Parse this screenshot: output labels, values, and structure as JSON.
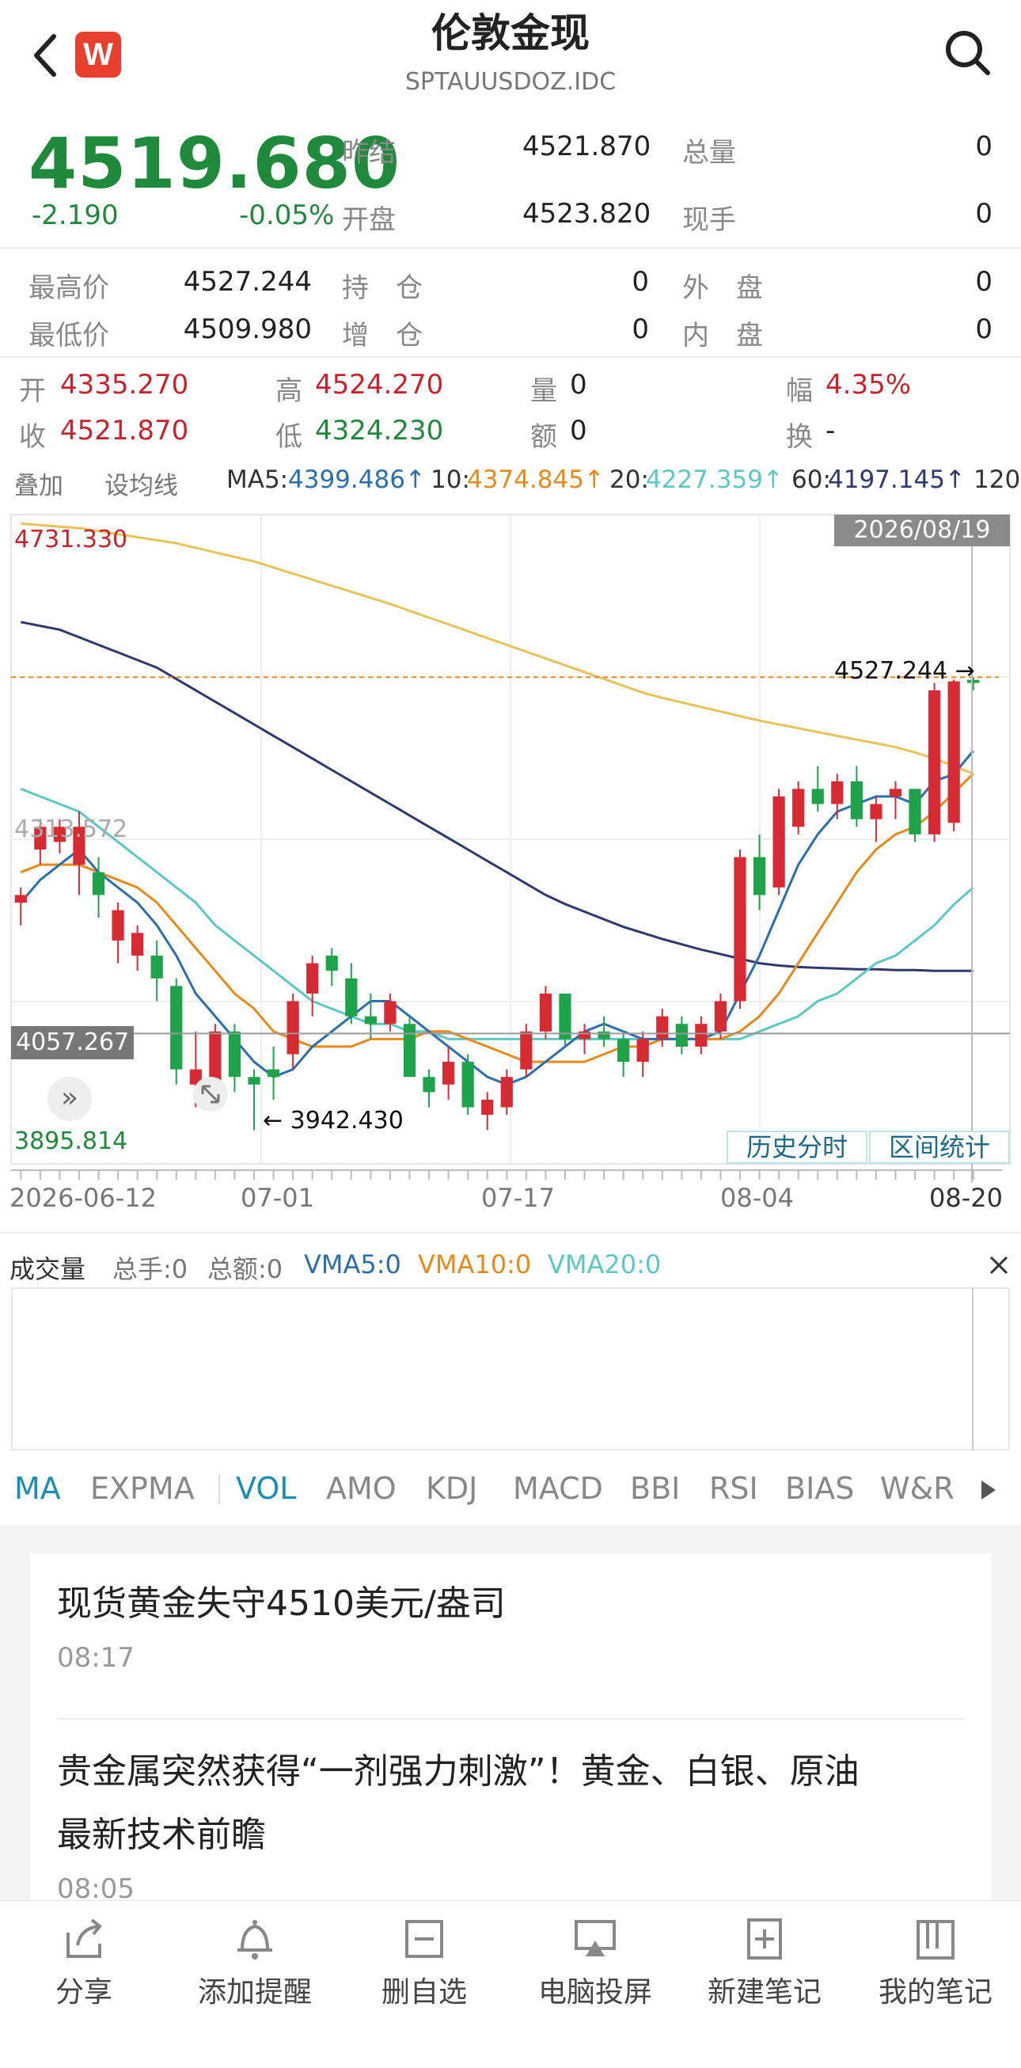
{
  "header": {
    "title": "伦敦金现",
    "code": "SPTAUUSDOZ.IDC",
    "brand_badge": "W"
  },
  "quote": {
    "price": "4519.680",
    "change": "-2.190",
    "change_pct": "-0.05%",
    "fields": [
      {
        "label": "昨结",
        "value": "4521.870"
      },
      {
        "label": "总量",
        "value": "0"
      },
      {
        "label": "开盘",
        "value": "4523.820"
      },
      {
        "label": "现手",
        "value": "0"
      },
      {
        "label": "最高价",
        "value": "4527.244"
      },
      {
        "label": "持　仓",
        "value": "0"
      },
      {
        "label": "外　盘",
        "value": "0"
      },
      {
        "label": "最低价",
        "value": "4509.980"
      },
      {
        "label": "增　仓",
        "value": "0"
      },
      {
        "label": "内　盘",
        "value": "0"
      }
    ]
  },
  "candle_info": {
    "open_label": "开",
    "open": "4335.270",
    "high_label": "高",
    "high": "4524.270",
    "vol_label": "量",
    "vol": "0",
    "amp_label": "幅",
    "amp": "4.35%",
    "close_label": "收",
    "close": "4521.870",
    "low_label": "低",
    "low": "4324.230",
    "amt_label": "额",
    "amt": "0",
    "turn_label": "换",
    "turn": "-"
  },
  "ma_bar": {
    "overlay": "叠加",
    "set_ma": "设均线",
    "ma5_label": "MA5:",
    "ma5": "4399.486↑",
    "ma10_label": "10:",
    "ma10": "4374.845↑",
    "ma20_label": "20:",
    "ma20": "4227.359↑",
    "ma60_label": "60:",
    "ma60": "4197.145↑",
    "ma120_label": "120"
  },
  "chart_labels": {
    "date_tag": "2026/08/19",
    "top_price": "4731.330",
    "mid_price": "4313.572",
    "cross_price": "4057.267",
    "bottom_price": "3895.814",
    "high_mark": "4527.244 →",
    "low_mark": "← 3942.430",
    "btn_history": "历史分时",
    "btn_range": "区间统计",
    "x_ticks": [
      "2026-06-12",
      "07-01",
      "07-17",
      "08-04",
      "08-20"
    ]
  },
  "chart_data": {
    "type": "candlestick",
    "x": [
      "2026-06-12",
      "2026-06-15",
      "2026-06-16",
      "2026-06-17",
      "2026-06-18",
      "2026-06-19",
      "2026-06-22",
      "2026-06-23",
      "2026-06-24",
      "2026-06-25",
      "2026-06-26",
      "2026-06-29",
      "2026-06-30",
      "2026-07-01",
      "2026-07-02",
      "2026-07-03",
      "2026-07-06",
      "2026-07-07",
      "2026-07-08",
      "2026-07-09",
      "2026-07-10",
      "2026-07-13",
      "2026-07-14",
      "2026-07-15",
      "2026-07-16",
      "2026-07-17",
      "2026-07-20",
      "2026-07-21",
      "2026-07-22",
      "2026-07-23",
      "2026-07-24",
      "2026-07-27",
      "2026-07-28",
      "2026-07-29",
      "2026-07-30",
      "2026-07-31",
      "2026-08-03",
      "2026-08-04",
      "2026-08-05",
      "2026-08-06",
      "2026-08-07",
      "2026-08-10",
      "2026-08-11",
      "2026-08-12",
      "2026-08-13",
      "2026-08-14",
      "2026-08-17",
      "2026-08-18",
      "2026-08-19",
      "2026-08-20"
    ],
    "ohlc": [
      [
        4230,
        4250,
        4200,
        4240
      ],
      [
        4300,
        4340,
        4280,
        4330
      ],
      [
        4310,
        4340,
        4295,
        4330
      ],
      [
        4280,
        4350,
        4240,
        4330
      ],
      [
        4270,
        4290,
        4210,
        4240
      ],
      [
        4180,
        4230,
        4150,
        4220
      ],
      [
        4160,
        4200,
        4140,
        4190
      ],
      [
        4160,
        4180,
        4100,
        4130
      ],
      [
        4120,
        4130,
        3990,
        4010
      ],
      [
        3990,
        4060,
        3960,
        4010
      ],
      [
        3990,
        4070,
        3960,
        4060
      ],
      [
        4060,
        4070,
        3980,
        4000
      ],
      [
        4000,
        4010,
        3930,
        3990
      ],
      [
        4010,
        4040,
        3970,
        4000
      ],
      [
        4030,
        4110,
        4010,
        4100
      ],
      [
        4110,
        4160,
        4080,
        4150
      ],
      [
        4160,
        4170,
        4120,
        4140
      ],
      [
        4130,
        4150,
        4070,
        4080
      ],
      [
        4080,
        4110,
        4050,
        4070
      ],
      [
        4070,
        4110,
        4060,
        4100
      ],
      [
        4070,
        4080,
        4000,
        4000
      ],
      [
        4000,
        4010,
        3960,
        3980
      ],
      [
        3990,
        4040,
        3970,
        4020
      ],
      [
        4020,
        4030,
        3950,
        3960
      ],
      [
        3950,
        3980,
        3930,
        3970
      ],
      [
        3960,
        4010,
        3950,
        4000
      ],
      [
        4010,
        4070,
        4000,
        4060
      ],
      [
        4060,
        4120,
        4050,
        4110
      ],
      [
        4110,
        4110,
        4040,
        4050
      ],
      [
        4050,
        4070,
        4030,
        4060
      ],
      [
        4060,
        4080,
        4040,
        4050
      ],
      [
        4050,
        4060,
        4000,
        4020
      ],
      [
        4020,
        4060,
        4000,
        4050
      ],
      [
        4050,
        4090,
        4040,
        4080
      ],
      [
        4070,
        4080,
        4030,
        4040
      ],
      [
        4040,
        4080,
        4030,
        4070
      ],
      [
        4060,
        4110,
        4050,
        4100
      ],
      [
        4100,
        4300,
        4090,
        4290
      ],
      [
        4290,
        4320,
        4220,
        4240
      ],
      [
        4250,
        4380,
        4240,
        4370
      ],
      [
        4330,
        4390,
        4320,
        4380
      ],
      [
        4380,
        4410,
        4350,
        4360
      ],
      [
        4360,
        4400,
        4340,
        4390
      ],
      [
        4390,
        4410,
        4330,
        4340
      ],
      [
        4340,
        4370,
        4310,
        4360
      ],
      [
        4370,
        4390,
        4340,
        4380
      ],
      [
        4380,
        4380,
        4310,
        4320
      ],
      [
        4320,
        4520,
        4310,
        4510
      ],
      [
        4335.27,
        4524.27,
        4324.23,
        4521.87
      ],
      [
        4523.82,
        4527.244,
        4509.98,
        4519.68
      ]
    ],
    "ma5": [
      4230,
      4260,
      4280,
      4300,
      4270,
      4250,
      4230,
      4200,
      4160,
      4110,
      4080,
      4050,
      4020,
      4000,
      4010,
      4040,
      4060,
      4080,
      4100,
      4100,
      4080,
      4060,
      4040,
      4020,
      4000,
      3990,
      4000,
      4020,
      4040,
      4060,
      4070,
      4060,
      4050,
      4050,
      4050,
      4050,
      4060,
      4110,
      4160,
      4220,
      4280,
      4320,
      4350,
      4360,
      4370,
      4370,
      4360,
      4390,
      4399.486,
      4430
    ],
    "ma10": [
      4270,
      4280,
      4280,
      4280,
      4270,
      4260,
      4250,
      4230,
      4200,
      4170,
      4140,
      4110,
      4090,
      4060,
      4050,
      4040,
      4040,
      4040,
      4050,
      4050,
      4050,
      4060,
      4060,
      4050,
      4040,
      4030,
      4020,
      4020,
      4020,
      4020,
      4030,
      4040,
      4040,
      4050,
      4050,
      4050,
      4050,
      4060,
      4080,
      4110,
      4150,
      4190,
      4230,
      4270,
      4300,
      4320,
      4330,
      4350,
      4374.845,
      4400
    ],
    "ma20": [
      4380,
      4370,
      4360,
      4350,
      4330,
      4310,
      4290,
      4270,
      4250,
      4230,
      4200,
      4180,
      4160,
      4140,
      4120,
      4100,
      4090,
      4080,
      4070,
      4070,
      4060,
      4060,
      4050,
      4050,
      4050,
      4050,
      4050,
      4050,
      4050,
      4050,
      4050,
      4050,
      4050,
      4050,
      4050,
      4050,
      4050,
      4050,
      4060,
      4070,
      4080,
      4100,
      4110,
      4130,
      4150,
      4160,
      4180,
      4200,
      4227.359,
      4250
    ],
    "ma60": [
      4600,
      4595,
      4590,
      4580,
      4570,
      4560,
      4550,
      4540,
      4525,
      4510,
      4495,
      4480,
      4465,
      4450,
      4435,
      4420,
      4405,
      4390,
      4375,
      4360,
      4345,
      4330,
      4315,
      4300,
      4285,
      4270,
      4255,
      4240,
      4228,
      4218,
      4208,
      4198,
      4190,
      4182,
      4175,
      4168,
      4162,
      4156,
      4150,
      4147,
      4145,
      4144,
      4143,
      4142,
      4142,
      4141,
      4141,
      4140,
      4140,
      4140
    ],
    "ma120": [
      4730,
      4728,
      4726,
      4724,
      4720,
      4716,
      4712,
      4708,
      4704,
      4698,
      4692,
      4686,
      4680,
      4672,
      4664,
      4656,
      4648,
      4640,
      4632,
      4624,
      4615,
      4606,
      4597,
      4588,
      4579,
      4570,
      4561,
      4552,
      4543,
      4534,
      4525,
      4516,
      4507,
      4500,
      4494,
      4488,
      4482,
      4476,
      4470,
      4465,
      4460,
      4455,
      4450,
      4445,
      4440,
      4435,
      4428,
      4420,
      4410,
      4400
    ],
    "ylim": [
      3895.814,
      4731.33
    ],
    "colors": {
      "up": "#d62b33",
      "down": "#1ea34a",
      "ma5": "#2c6fae",
      "ma10": "#e88a1a",
      "ma20": "#5cc8c4",
      "ma60": "#2e3a6e",
      "ma120": "#e6c45a"
    }
  },
  "volume": {
    "title": "成交量",
    "total_hands": "总手:0",
    "total_amount": "总额:0",
    "vma5": "VMA5:0",
    "vma10": "VMA10:0",
    "vma20": "VMA20:0"
  },
  "indicator_tabs": [
    "MA",
    "EXPMA",
    "VOL",
    "AMO",
    "KDJ",
    "MACD",
    "BBI",
    "RSI",
    "BIAS",
    "W&R"
  ],
  "news": [
    {
      "title": "现货黄金失守4510美元/盎司",
      "time": "08:17"
    },
    {
      "title_line1": "贵金属突然获得“一剂强力刺激”！黄金、白银、原油",
      "title_line2": "最新技术前瞻",
      "time": "08:05"
    }
  ],
  "bottom_nav": [
    {
      "label": "分享",
      "icon": "share-icon"
    },
    {
      "label": "添加提醒",
      "icon": "bell-icon"
    },
    {
      "label": "删自选",
      "icon": "remove-watchlist-icon"
    },
    {
      "label": "电脑投屏",
      "icon": "screen-cast-icon"
    },
    {
      "label": "新建笔记",
      "icon": "new-note-icon"
    },
    {
      "label": "我的笔记",
      "icon": "my-notes-icon"
    }
  ]
}
